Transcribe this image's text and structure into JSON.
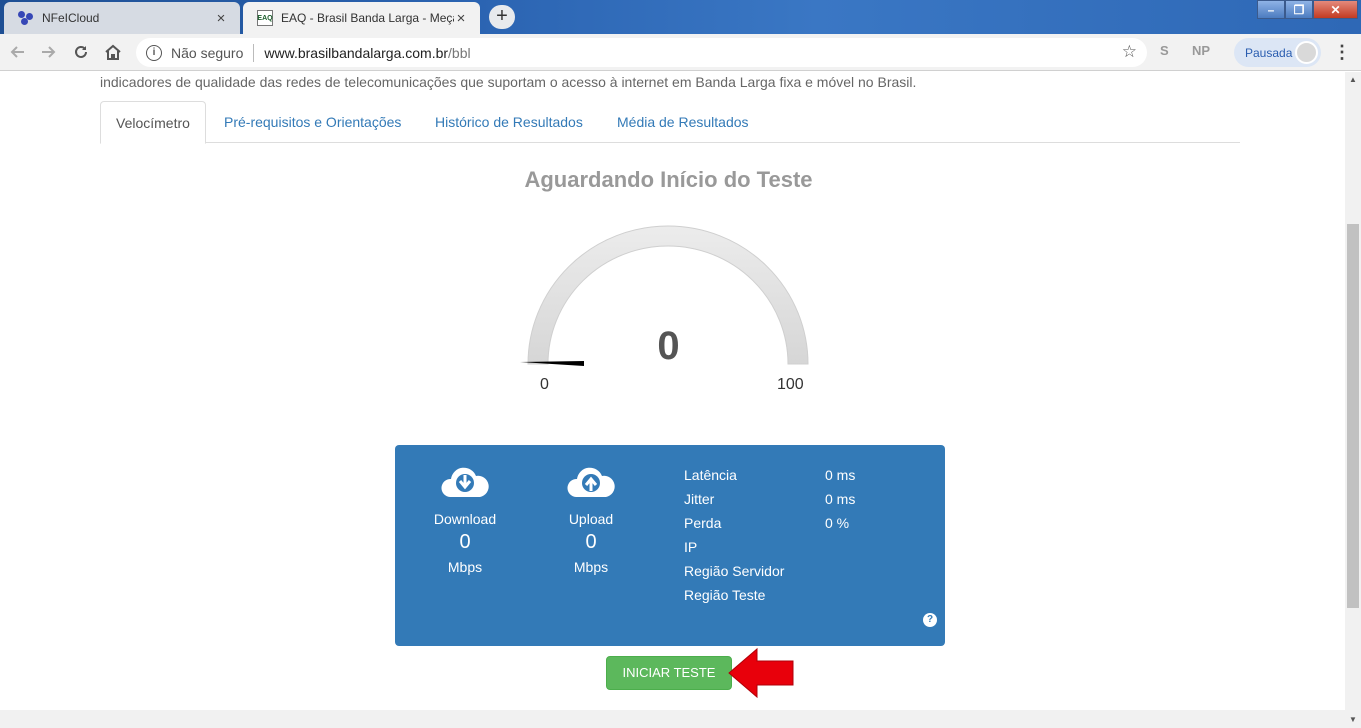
{
  "browser": {
    "tabs": [
      {
        "title": "NFeICloud",
        "icon": "nfeicloud-icon",
        "active": false
      },
      {
        "title": "EAQ - Brasil Banda Larga - Meça",
        "icon": "eaq-icon",
        "active": true
      }
    ],
    "eaq_favicon_text": "EAQ",
    "close_glyph": "×",
    "new_tab_glyph": "+",
    "window_controls": {
      "minimize": "–",
      "maximize": "❐",
      "close": "✕"
    },
    "security_label": "Não seguro",
    "url_host": "www.brasilbandalarga.com.br",
    "url_path": "/bbl",
    "extensions": [
      "S",
      "NP"
    ],
    "profile_label": "Pausada"
  },
  "page": {
    "intro": "indicadores de qualidade das redes de telecomunicações que suportam o acesso à internet em Banda Larga fixa e móvel no Brasil.",
    "tabs": [
      "Velocímetro",
      "Pré-requisitos e Orientações",
      "Histórico de Resultados",
      "Média de Resultados"
    ],
    "status_title": "Aguardando Início do Teste",
    "gauge": {
      "value": "0",
      "min": "0",
      "max": "100",
      "level": 0
    },
    "download": {
      "label": "Download",
      "value": "0",
      "unit": "Mbps"
    },
    "upload": {
      "label": "Upload",
      "value": "0",
      "unit": "Mbps"
    },
    "stats": [
      {
        "key": "Latência",
        "value": "0 ms"
      },
      {
        "key": "Jitter",
        "value": "0 ms"
      },
      {
        "key": "Perda",
        "value": "0 %"
      },
      {
        "key": "IP",
        "value": ""
      },
      {
        "key": "Região Servidor",
        "value": ""
      },
      {
        "key": "Região Teste",
        "value": ""
      }
    ],
    "help_glyph": "?",
    "start_button": "INICIAR TESTE"
  },
  "colors": {
    "panel": "#337ab7",
    "start_button": "#5cb85c",
    "arrow": "#e8000b",
    "link": "#337ab7"
  }
}
